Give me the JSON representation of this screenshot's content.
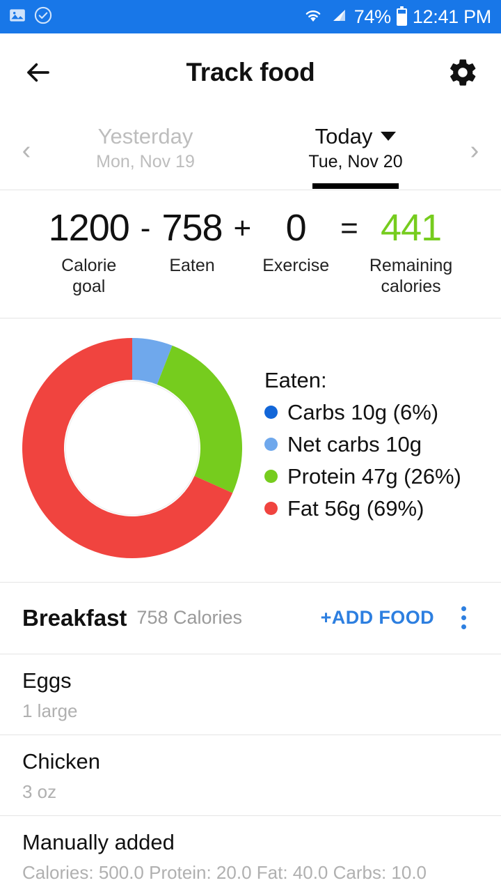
{
  "statusbar": {
    "icons": [
      "image-icon",
      "check-circle-icon",
      "wifi-icon",
      "signal-icon"
    ],
    "battery_text": "74%",
    "time": "12:41 PM",
    "bg_color": "#1877e8"
  },
  "appbar": {
    "title": "Track food",
    "back_icon": "back-arrow-icon",
    "settings_icon": "gear-icon"
  },
  "datebar": {
    "prev_icon": "chevron-left-icon",
    "next_icon": "chevron-right-icon",
    "days": [
      {
        "label": "Yesterday",
        "date": "Mon, Nov 19",
        "selected": false
      },
      {
        "label": "Today",
        "date": "Tue, Nov 20",
        "selected": true
      }
    ]
  },
  "summary": {
    "goal_value": "1200",
    "goal_label_line1": "Calorie",
    "goal_label_line2": "goal",
    "op_minus": "-",
    "eaten_value": "758",
    "eaten_label": "Eaten",
    "op_plus": "+",
    "exercise_value": "0",
    "exercise_label": "Exercise",
    "op_equals": "=",
    "remaining_value": "441",
    "remaining_label_line1": "Remaining",
    "remaining_label_line2": "calories",
    "remaining_color": "#76cc1e"
  },
  "chart_data": {
    "type": "pie",
    "title": "Eaten:",
    "donut": true,
    "start_angle_deg": 0,
    "categories": [
      "Net carbs",
      "Protein",
      "Fat"
    ],
    "values": [
      6,
      26,
      69
    ],
    "colors": [
      "#6fa8ec",
      "#76cc1e",
      "#f0443f"
    ],
    "legend_position": "right",
    "legend": [
      {
        "name": "carbs",
        "color": "#1266d8",
        "text": "Carbs 10g (6%)",
        "grams": 10,
        "percent": 6
      },
      {
        "name": "net-carbs",
        "color": "#6fa8ec",
        "text": "Net carbs 10g",
        "grams": 10,
        "percent": 6
      },
      {
        "name": "protein",
        "color": "#76cc1e",
        "text": "Protein 47g (26%)",
        "grams": 47,
        "percent": 26
      },
      {
        "name": "fat",
        "color": "#f0443f",
        "text": "Fat 56g (69%)",
        "grams": 56,
        "percent": 69
      }
    ]
  },
  "meal": {
    "name": "Breakfast",
    "calories": "758 Calories",
    "add_food_label": "+ADD FOOD",
    "overflow_icon": "kebab-menu-icon",
    "items": [
      {
        "name": "Eggs",
        "detail": "1 large"
      },
      {
        "name": "Chicken",
        "detail": "3 oz"
      },
      {
        "name": "Manually added",
        "detail": "Calories: 500.0 Protein: 20.0 Fat: 40.0 Carbs: 10.0"
      }
    ]
  }
}
